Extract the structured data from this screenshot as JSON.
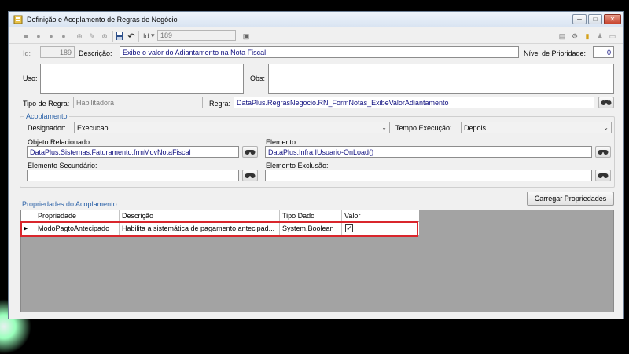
{
  "window": {
    "title": "Definição e Acoplamento de Regras de Negócio",
    "controls": {
      "minimize": "─",
      "maximize": "□",
      "close": "✕"
    }
  },
  "toolbar": {
    "id_label": "Id",
    "id_value": "189"
  },
  "fields": {
    "id_label": "Id:",
    "id_value": "189",
    "descricao_label": "Descrição:",
    "descricao_value": "Exibe o valor do Adiantamento na Nota Fiscal",
    "prioridade_label": "Nível de Prioridade:",
    "prioridade_value": "0",
    "uso_label": "Uso:",
    "obs_label": "Obs:",
    "tipo_regra_label": "Tipo de Regra:",
    "tipo_regra_value": "Habilitadora",
    "regra_label": "Regra:",
    "regra_value": "DataPlus.RegrasNegocio.RN_FormNotas_ExibeValorAdiantamento"
  },
  "acoplamento": {
    "title": "Acoplamento",
    "designador_label": "Designador:",
    "designador_value": "Execucao",
    "tempo_label": "Tempo Execução:",
    "tempo_value": "Depois",
    "objeto_label": "Objeto Relacionado:",
    "objeto_value": "DataPlus.Sistemas.Faturamento.frmMovNotaFiscal",
    "elemento_label": "Elemento:",
    "elemento_value": "DataPlus.Infra.IUsuario-OnLoad()",
    "elemento_sec_label": "Elemento Secundário:",
    "elemento_sec_value": "",
    "elemento_exc_label": "Elemento Exclusão:",
    "elemento_exc_value": ""
  },
  "propriedades": {
    "title": "Propriedades do Acoplamento",
    "load_button": "Carregar Propriedades",
    "columns": [
      "Propriedade",
      "Descrição",
      "Tipo Dado",
      "Valor"
    ],
    "rows": [
      {
        "propriedade": "ModoPagtoAntecipado",
        "descricao": "Habilita a sistemática de pagamento antecipad...",
        "tipo": "System.Boolean",
        "valor": "✓"
      }
    ]
  },
  "colors": {
    "title_accent": "#2d63a8",
    "value_text": "#101080",
    "highlight": "#d9262c"
  }
}
